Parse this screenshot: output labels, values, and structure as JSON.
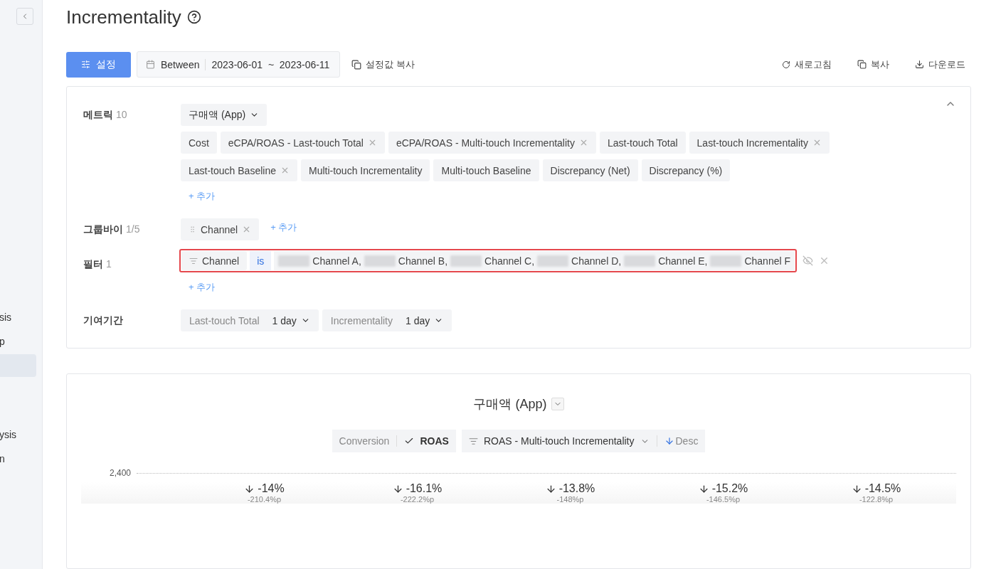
{
  "sidebar": {
    "items": [
      {
        "label": "sis",
        "selected": false
      },
      {
        "label": "p",
        "selected": false
      },
      {
        "selected": true
      },
      {
        "label": "ysis",
        "selected": false
      },
      {
        "label": "n",
        "selected": false
      }
    ]
  },
  "title": "Incrementality",
  "toolbar": {
    "settings_button": "설정",
    "date_range": {
      "operator": "Between",
      "value": "2023-06-01  ~  2023-06-11"
    },
    "copy_settings": "설정값 복사",
    "actions": [
      {
        "kind": "refresh",
        "label": "새로고침"
      },
      {
        "kind": "copy",
        "label": "복사"
      },
      {
        "kind": "download",
        "label": "다운로드"
      }
    ]
  },
  "settings": {
    "expanded": true,
    "metrics": {
      "label": "메트릭",
      "count": "10",
      "selector": "구매액 (App)",
      "chips": [
        {
          "label": "Cost",
          "removable": false
        },
        {
          "label": "eCPA/ROAS - Last-touch Total",
          "removable": true
        },
        {
          "label": "eCPA/ROAS - Multi-touch Incrementality",
          "removable": true
        },
        {
          "label": "Last-touch Total",
          "removable": false
        },
        {
          "label": "Last-touch Incrementality",
          "removable": true
        },
        {
          "label": "Last-touch Baseline",
          "removable": true
        },
        {
          "label": "Multi-touch Incrementality",
          "removable": false
        },
        {
          "label": "Multi-touch Baseline",
          "removable": false
        },
        {
          "label": "Discrepancy (Net)",
          "removable": false
        },
        {
          "label": "Discrepancy (%)",
          "removable": false
        }
      ],
      "add": "+ 추가"
    },
    "group_by": {
      "label": "그룹바이",
      "count": "1/5",
      "chips": [
        {
          "label": "Channel",
          "removable": true
        }
      ],
      "add": "+ 추가"
    },
    "filter": {
      "label": "필터",
      "count": "1",
      "field": "Channel",
      "operator": "is",
      "values": [
        "Channel A,",
        "Channel B,",
        "Channel C,",
        "Channel D,",
        "Channel E,",
        "Channel F"
      ],
      "highlighted": true,
      "add": "+ 추가"
    },
    "attribution": {
      "label": "기여기간",
      "windows": [
        {
          "label": "Last-touch Total",
          "value": "1 day"
        },
        {
          "label": "Incrementality",
          "value": "1 day"
        }
      ]
    }
  },
  "chart_panel": {
    "title": "구매액 (App)",
    "modes": [
      {
        "label": "Conversion",
        "selected": false
      },
      {
        "label": "ROAS",
        "selected": true
      }
    ],
    "sort_by": "ROAS - Multi-touch Incrementality",
    "sort_order": "Desc",
    "y_tick": "2,400",
    "bars": [
      {
        "change": "-14%",
        "diff": "-210.4%p"
      },
      {
        "change": "-16.1%",
        "diff": "-222.2%p"
      },
      {
        "change": "-13.8%",
        "diff": "-148%p"
      },
      {
        "change": "-15.2%",
        "diff": "-146.5%p"
      },
      {
        "change": "-14.5%",
        "diff": "-122.8%p"
      }
    ]
  }
}
